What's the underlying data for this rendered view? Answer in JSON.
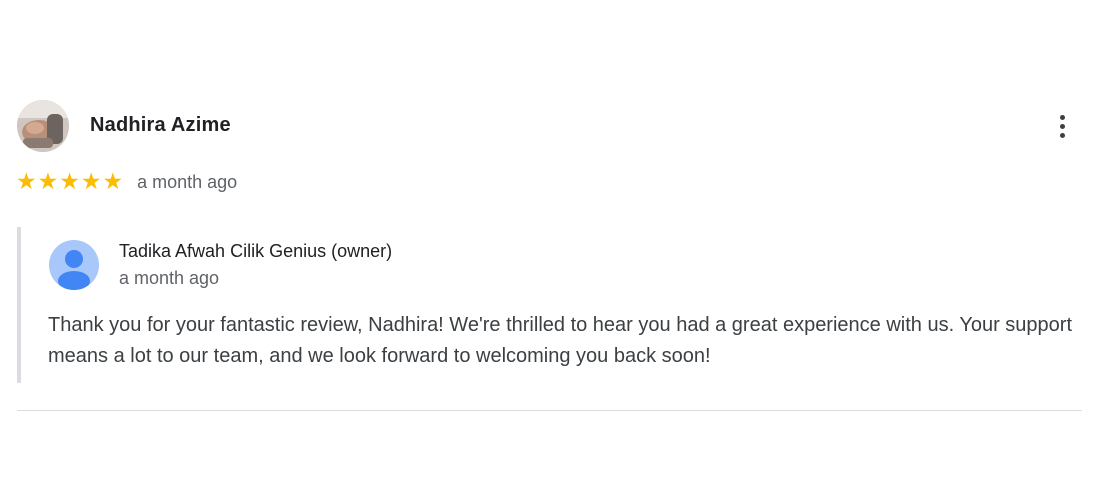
{
  "review": {
    "reviewer_name": "Nadhira Azime",
    "avatar_icon": "user-photo-avatar",
    "more_icon": "more-vert-icon",
    "rating": 5,
    "rating_max": 5,
    "star_color": "#fbbc04",
    "time": "a month ago"
  },
  "reply": {
    "owner_name": "Tadika Afwah Cilik Genius (owner)",
    "owner_avatar_icon": "default-user-icon",
    "owner_avatar_color": "#a8c7fa",
    "time": "a month ago",
    "text": "Thank you for your fantastic review, Nadhira! We're thrilled to hear you had a great experience with us. Your support means a lot to our team, and we look forward to welcoming you back soon!"
  }
}
